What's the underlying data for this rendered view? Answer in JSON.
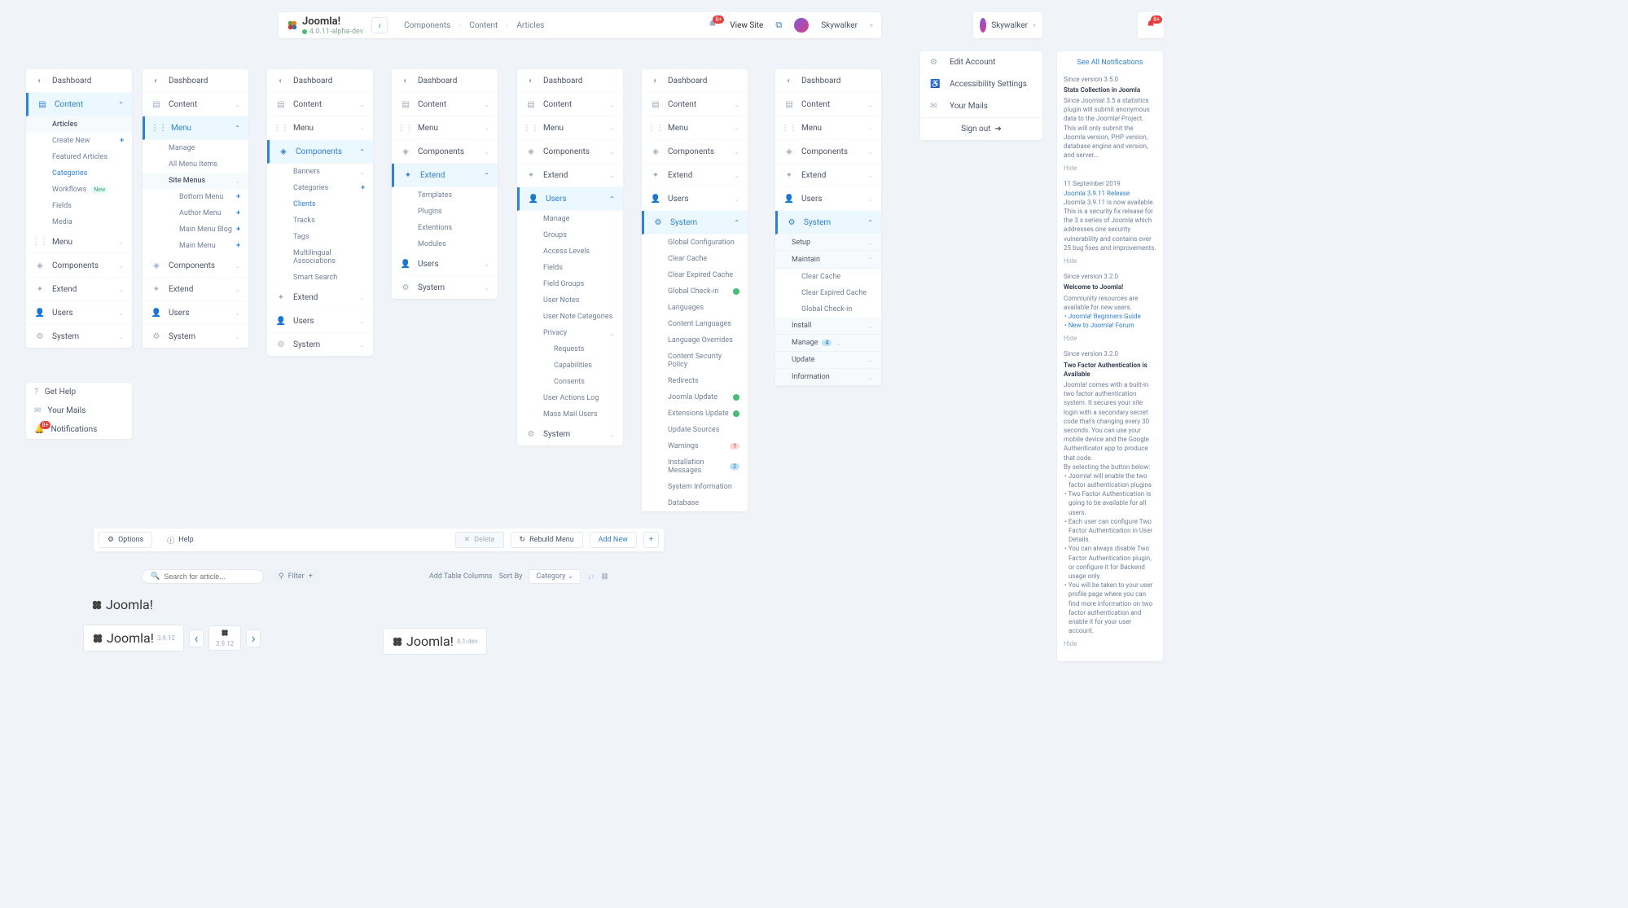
{
  "header": {
    "brand": "Joomla!",
    "version_sub": "4.0.11-alpha-dev",
    "crumb1": "Components",
    "crumb2": "Content",
    "crumb3": "Articles",
    "notif_badge": "8+",
    "view_site": "View Site",
    "user": "Skywalker"
  },
  "user_top": {
    "name": "Skywalker"
  },
  "nav_labels": {
    "dashboard": "Dashboard",
    "content": "Content",
    "menu": "Menu",
    "components": "Components",
    "extend": "Extend",
    "users": "Users",
    "system": "System"
  },
  "content_sub": {
    "articles": "Articles",
    "create_new": "Create New",
    "featured": "Featured Articles",
    "categories": "Categories",
    "workflows": "Workflows",
    "workflows_badge": "New",
    "fields": "Fields",
    "media": "Media"
  },
  "menu_sub": {
    "manage": "Manage",
    "all_items": "All Menu Items",
    "site_menus": "Site Menus",
    "bottom": "Bottom Menu",
    "author": "Author Menu",
    "blog": "Main Menu Blog",
    "main": "Main Menu"
  },
  "comp_sub": {
    "banners": "Banners",
    "categories": "Categories",
    "clients": "Clients",
    "tracks": "Tracks",
    "tags": "Tags",
    "multiling": "Multilingual Associations",
    "smart": "Smart Search"
  },
  "extend_sub": {
    "templates": "Templates",
    "plugins": "Plugins",
    "extensions": "Extentions",
    "modules": "Modules"
  },
  "users_sub": {
    "manage": "Manage",
    "groups": "Groups",
    "access": "Access Levels",
    "fields": "Fields",
    "field_groups": "Field Groups",
    "notes": "User Notes",
    "note_cats": "User Note Categories",
    "privacy": "Privacy",
    "requests": "Requests",
    "capabilities": "Capabilities",
    "consents": "Consents",
    "actions_log": "User Actions Log",
    "mass_mail": "Mass Mail Users"
  },
  "system_sub": {
    "global": "Global Configuration",
    "clear_cache": "Clear Cache",
    "clear_exp": "Clear Expired Cache",
    "checkin": "Global Check-in",
    "langs": "Languages",
    "content_langs": "Content Languages",
    "lang_over": "Language Overrides",
    "csp": "Content Security Policy",
    "redirects": "Redirects",
    "joomla_upd": "Joomla Update",
    "ext_upd": "Extensions Update",
    "upd_src": "Update Sources",
    "warnings": "Warnings",
    "warnings_badge": "1",
    "install_msg": "Installation Messages",
    "install_badge": "2",
    "sysinfo": "System Information",
    "database": "Database"
  },
  "system_sections": {
    "setup": "Setup",
    "maintain": "Maintain",
    "install": "Install",
    "manage": "Manage",
    "manage_badge": "4",
    "update": "Update",
    "information": "Information"
  },
  "help_panel": {
    "get_help": "Get Help",
    "mails": "Your Mails",
    "notifications": "Notifications",
    "notif_badge": "8+"
  },
  "user_menu": {
    "edit": "Edit Account",
    "access": "Accessibility Settings",
    "mails": "Your Mails",
    "signout": "Sign out"
  },
  "notifications": {
    "see_all": "See All Notifications",
    "n1_since": "Since version 3.5.0",
    "n1_title": "Stats Collection in Joomla",
    "n1_body": "Since Joomla! 3.5 a statistics plugin will submit anonymous data to the Joomla! Project. This will only submit the Joomla version, PHP version, database engine and version, and server...",
    "hide": "Hide",
    "n2_date": "11 September 2019",
    "n2_link": "Joomla 3.9.11 Release",
    "n2_body": "Joomla 3.9.11 is now available. This is a security fix release for the 3.x series of Joomla which addresses one security vulnerability and contains over 25 bug fixes and improvements.",
    "n3_since": "Since version 3.2.0",
    "n3_title": "Welcome to Joomla!",
    "n3_body": "Community resources are available for new users.",
    "n3_link1": "Joomla! Beginners Guide",
    "n3_link2": "New to Joomla! Forum",
    "n4_since": "Since version 3.2.0",
    "n4_title": "Two Factor Authentication is Available",
    "n4_body": "Joomla! comes with a built-in two factor authentication system. It secures your site login with a secondary secret code that's changing every 30 seconds. You can use your mobile device and the Google Authenticator app to produce that code.",
    "n4_sub": "By selecting the button below:",
    "n4_b1": "Joomla! will enable the two factor authentication plugins",
    "n4_b2": "Two Factor Authentication is going to be available for all users.",
    "n4_b3": "Each user can configure Two Factor Authentication in User Details.",
    "n4_b4": "You can always disable Two Factor Authentication plugin, or configure it for Backend usage only.",
    "n4_b5": "You will be taken to your user profile page where you can find more information on two factor authentication and enable it for your user account."
  },
  "toolbar": {
    "options": "Options",
    "help": "Help",
    "delete": "Delete",
    "rebuild": "Rebuild Menu",
    "add_new": "Add New"
  },
  "filters": {
    "search_ph": "Search for article...",
    "filter": "Filter",
    "add_cols": "Add Table Columns",
    "sort_by": "Sort By",
    "category": "Category"
  },
  "logos": {
    "joomla": "Joomla!",
    "v1": "3.9.12",
    "v2": "3.9.12",
    "v3": "4.1-dev"
  }
}
